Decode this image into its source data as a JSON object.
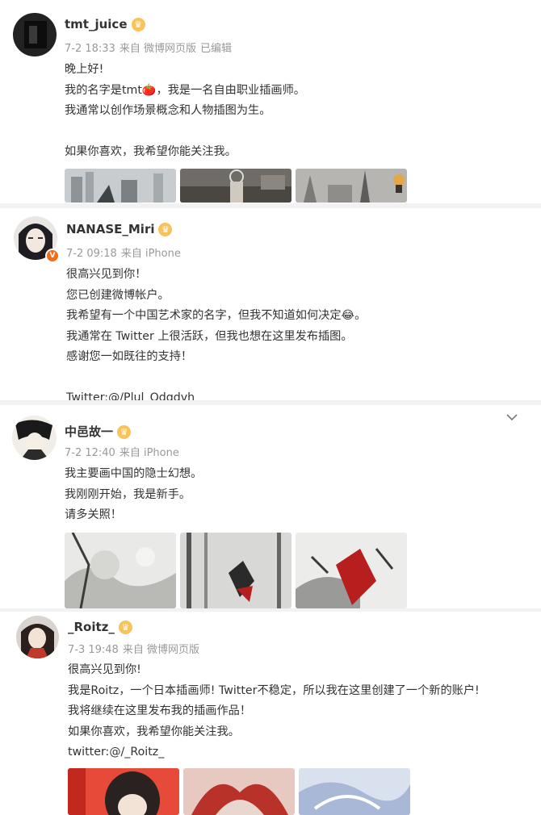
{
  "posts": [
    {
      "username": "tmt_juice",
      "date": "7-2 18:33",
      "source": "来自 微博网页版",
      "edited": "已编辑",
      "lines": [
        "晚上好!",
        "我的名字是tmt🍅，我是一名自由职业插画师。",
        "我通常以创作场景概念和人物插图为生。",
        "",
        "如果你喜欢，我希望你能关注我。"
      ]
    },
    {
      "username": "NANASE_Miri",
      "date": "7-2 09:18",
      "source": "来自 iPhone",
      "lines": [
        "很高兴见到你！",
        "您已创建微博帐户。",
        "我希望有一个中国艺术家的名字，但我不知道如何决定😂。",
        "我通常在 Twitter 上很活跃，但我也想在这里发布插图。",
        "感谢您一如既往的支持！",
        "",
        "Twitter:@/Plul_Qdqdvh"
      ]
    },
    {
      "username": "中邑故一",
      "date": "7-2 12:40",
      "source": "来自 iPhone",
      "lines": [
        "我主要画中国的隐士幻想。",
        "我刚刚开始，我是新手。",
        "请多关照！"
      ]
    },
    {
      "username": "_Roitz_",
      "date": "7-3 19:48",
      "source": "来自 微博网页版",
      "lines": [
        "很高兴见到你!",
        "我是Roitz，一个日本插画师! Twitter不稳定，所以我在这里创建了一个新的账户!",
        "我将继续在这里发布我的插画作品！",
        "如果你喜欢，我希望你能关注我。",
        "twitter:@/_Roitz_"
      ]
    }
  ],
  "icons": {
    "crown": "crown-badge-icon",
    "verified": "verified-badge-icon",
    "chevron": "chevron-down-icon"
  },
  "colors": {
    "meta": "#999999",
    "text": "#333333",
    "crown": "#f7c35a",
    "verified": "#f26c1c"
  }
}
